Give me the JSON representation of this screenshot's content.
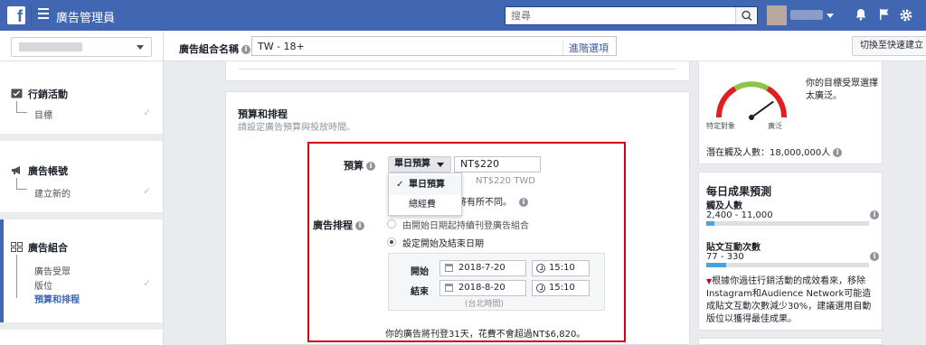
{
  "topbar": {
    "logo_letter": "f",
    "app_title": "廣告管理員",
    "search_placeholder": "搜尋",
    "icons": [
      "facebook-logo-icon",
      "hamburger-icon",
      "search-icon",
      "bell-icon",
      "flag-icon",
      "gear-icon"
    ]
  },
  "subbar": {
    "adset_name_label": "廣告組合名稱",
    "adset_name_value": "TW - 18+",
    "advanced_options": "進階選項",
    "quick_create": "切換至快速建立"
  },
  "sidebar": {
    "groups": [
      {
        "title": "行銷活動",
        "icon": "campaign-icon",
        "items": [
          {
            "label": "目標",
            "checked": true
          }
        ]
      },
      {
        "title": "廣告帳號",
        "icon": "megaphone-icon",
        "items": [
          {
            "label": "建立新的",
            "checked": true
          }
        ]
      },
      {
        "title": "廣告組合",
        "icon": "adset-grid-icon",
        "items": [
          {
            "label": "廣告受眾",
            "checked": false
          },
          {
            "label": "版位",
            "checked": true
          },
          {
            "label": "預算和排程",
            "checked": false,
            "active": true
          }
        ]
      }
    ]
  },
  "budget_section": {
    "title": "預算和排程",
    "subtitle": "請設定廣告預算與投放時間。",
    "budget_label": "預算",
    "budget_type": "單日預算",
    "budget_amount": "NT$220",
    "budget_note": "NT$220 TWD",
    "partial_note": "將有所不同。",
    "dropdown_options": [
      {
        "label": "單日預算",
        "selected": true
      },
      {
        "label": "總經費",
        "selected": false
      }
    ],
    "schedule_label": "廣告排程",
    "schedule_options": [
      {
        "label": "由開始日期起持續刊登廣告組合",
        "selected": false
      },
      {
        "label": "設定開始及結束日期",
        "selected": true
      }
    ],
    "start_label": "開始",
    "start_date": "2018-7-20",
    "start_time": "15:10",
    "end_label": "結束",
    "end_date": "2018-8-20",
    "end_time": "15:10",
    "timezone": "(台北時間)",
    "summary": "你的廣告將刊登31天，花費不會超過NT$6,820。"
  },
  "audience_panel": {
    "gauge_text": "你的目標受眾選擇太廣泛。",
    "gauge_left": "特定對象",
    "gauge_right": "廣泛",
    "gauge_level": 0.8,
    "potential_reach": "潛在觸及人數：18,000,000人"
  },
  "daily_results": {
    "title": "每日成果預測",
    "metrics": [
      {
        "name": "觸及人數",
        "range": "2,400 - 11,000",
        "fill": 0.05
      },
      {
        "name": "貼文互動次數",
        "range": "77 - 330",
        "fill": 0.12
      }
    ],
    "tip": "根據你過往行銷活動的成效看來，移除Instagram和Audience Network可能造成貼文互動次數減少30%，建議選用自動版位以獲得最佳成果。"
  },
  "colors": {
    "brand": "#4267b2",
    "highlight_border": "#d0021b",
    "bar_fill": "#4aa3df"
  }
}
